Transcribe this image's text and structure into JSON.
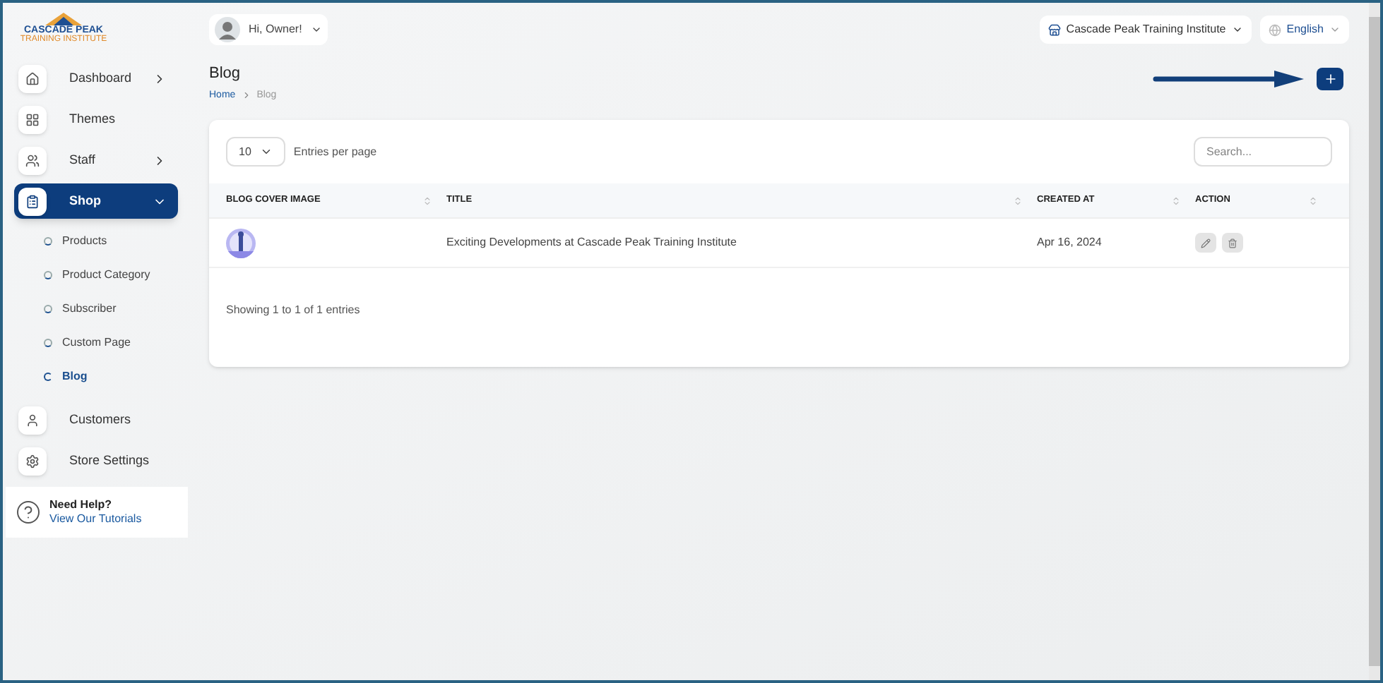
{
  "logo": {
    "name": "CASCADE PEAK",
    "tagline": "TRAINING INSTITUTE"
  },
  "sidebar": {
    "items": [
      {
        "label": "Dashboard",
        "kind": "group",
        "selected": false,
        "expanded": false
      },
      {
        "label": "Themes",
        "kind": "link",
        "selected": false
      },
      {
        "label": "Staff",
        "kind": "group",
        "selected": false,
        "expanded": false
      },
      {
        "label": "Shop",
        "kind": "group",
        "selected": true,
        "expanded": true,
        "children": [
          {
            "label": "Products",
            "selected": false
          },
          {
            "label": "Product Category",
            "selected": false
          },
          {
            "label": "Subscriber",
            "selected": false
          },
          {
            "label": "Custom Page",
            "selected": false
          },
          {
            "label": "Blog",
            "selected": true
          }
        ]
      },
      {
        "label": "Customers",
        "kind": "link",
        "selected": false
      },
      {
        "label": "Store Settings",
        "kind": "link",
        "selected": false
      }
    ],
    "help": {
      "title": "Need Help?",
      "link": "View Our Tutorials"
    }
  },
  "header": {
    "greeting": "Hi, Owner!",
    "store": "Cascade Peak Training Institute",
    "language": "English"
  },
  "page": {
    "title": "Blog",
    "breadcrumb": [
      {
        "label": "Home",
        "selected": false
      },
      {
        "label": "Blog",
        "selected": true
      }
    ]
  },
  "table": {
    "page_size": "10",
    "page_size_label": "Entries per page",
    "search": {
      "placeholder": "Search..."
    },
    "columns": [
      "BLOG COVER IMAGE",
      "TITLE",
      "CREATED AT",
      "ACTION"
    ],
    "rows": [
      {
        "title": "Exciting Developments at Cascade Peak Training Institute",
        "created_at": "Apr 16, 2024"
      }
    ],
    "footer": "Showing 1 to 1 of 1 entries"
  }
}
